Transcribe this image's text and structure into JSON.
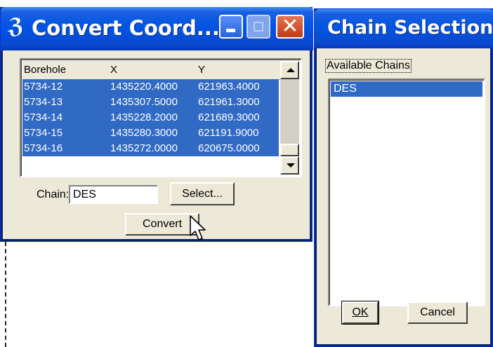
{
  "convert_window": {
    "title": "Convert Coord...",
    "icon": "app-icon",
    "controls": {
      "minimize": "minimize-icon",
      "maximize": "maximize-icon",
      "close": "✕"
    },
    "list": {
      "columns": [
        "Borehole",
        "X",
        "Y"
      ],
      "rows": [
        [
          "5734-12",
          "1435220.4000",
          "621963.4000"
        ],
        [
          "5734-13",
          "1435307.5000",
          "621961.3000"
        ],
        [
          "5734-14",
          "1435228.2000",
          "621689.3000"
        ],
        [
          "5734-15",
          "1435280.3000",
          "621191.9000"
        ],
        [
          "5734-16",
          "1435272.0000",
          "620675.0000"
        ]
      ]
    },
    "chain_label": "Chain:",
    "chain_value": "DES",
    "select_label": "Select...",
    "convert_label": "Convert"
  },
  "chain_window": {
    "title": "Chain Selection",
    "available_label": "Available Chains",
    "chains": [
      "DES"
    ],
    "ok_label": "OK",
    "cancel_label": "Cancel"
  },
  "colors": {
    "titlebar": "#0054e3",
    "selection": "#316ac5",
    "face": "#ece9d8",
    "close_button": "#c23b18"
  }
}
